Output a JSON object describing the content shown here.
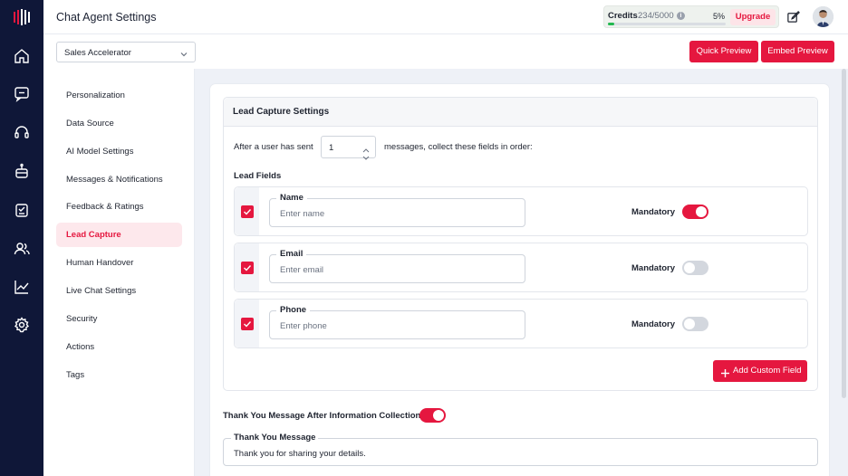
{
  "header": {
    "title": "Chat Agent Settings",
    "credits_label": "Credits",
    "credits_value": "234/5000",
    "credits_percent": "5%",
    "credits_fraction": 0.05,
    "upgrade_label": "Upgrade"
  },
  "toolbar": {
    "agent_selected": "Sales Accelerator",
    "quick_preview": "Quick Preview",
    "embed_preview": "Embed Preview"
  },
  "rail_icons": [
    "brand-logo",
    "home-icon",
    "chat-icon",
    "headset-icon",
    "bot-icon",
    "tasks-icon",
    "users-icon",
    "analytics-icon",
    "settings-icon"
  ],
  "menu": {
    "items": [
      {
        "label": "Personalization"
      },
      {
        "label": "Data Source"
      },
      {
        "label": "AI Model Settings"
      },
      {
        "label": "Messages & Notifications"
      },
      {
        "label": "Feedback & Ratings"
      },
      {
        "label": "Lead Capture",
        "active": true
      },
      {
        "label": "Human Handover"
      },
      {
        "label": "Live Chat Settings"
      },
      {
        "label": "Security"
      },
      {
        "label": "Actions"
      },
      {
        "label": "Tags"
      }
    ]
  },
  "lead_capture": {
    "title": "Lead Capture Settings",
    "after_prefix": "After a user has sent",
    "message_count": "1",
    "after_suffix": "messages, collect these fields in order:",
    "fields_label": "Lead Fields",
    "mandatory_label": "Mandatory",
    "fields": [
      {
        "name": "Name",
        "placeholder": "Enter name",
        "checked": true,
        "mandatory": true
      },
      {
        "name": "Email",
        "placeholder": "Enter email",
        "checked": true,
        "mandatory": false
      },
      {
        "name": "Phone",
        "placeholder": "Enter phone",
        "checked": true,
        "mandatory": false
      }
    ],
    "add_custom_field": "Add Custom Field"
  },
  "thank_you": {
    "toggle_label": "Thank You Message After Information Collection",
    "enabled": true,
    "field_label": "Thank You Message",
    "message": "Thank you for sharing your details."
  },
  "colors": {
    "accent": "#e5173f",
    "rail": "#0f1738",
    "progress": "#22b84f"
  }
}
